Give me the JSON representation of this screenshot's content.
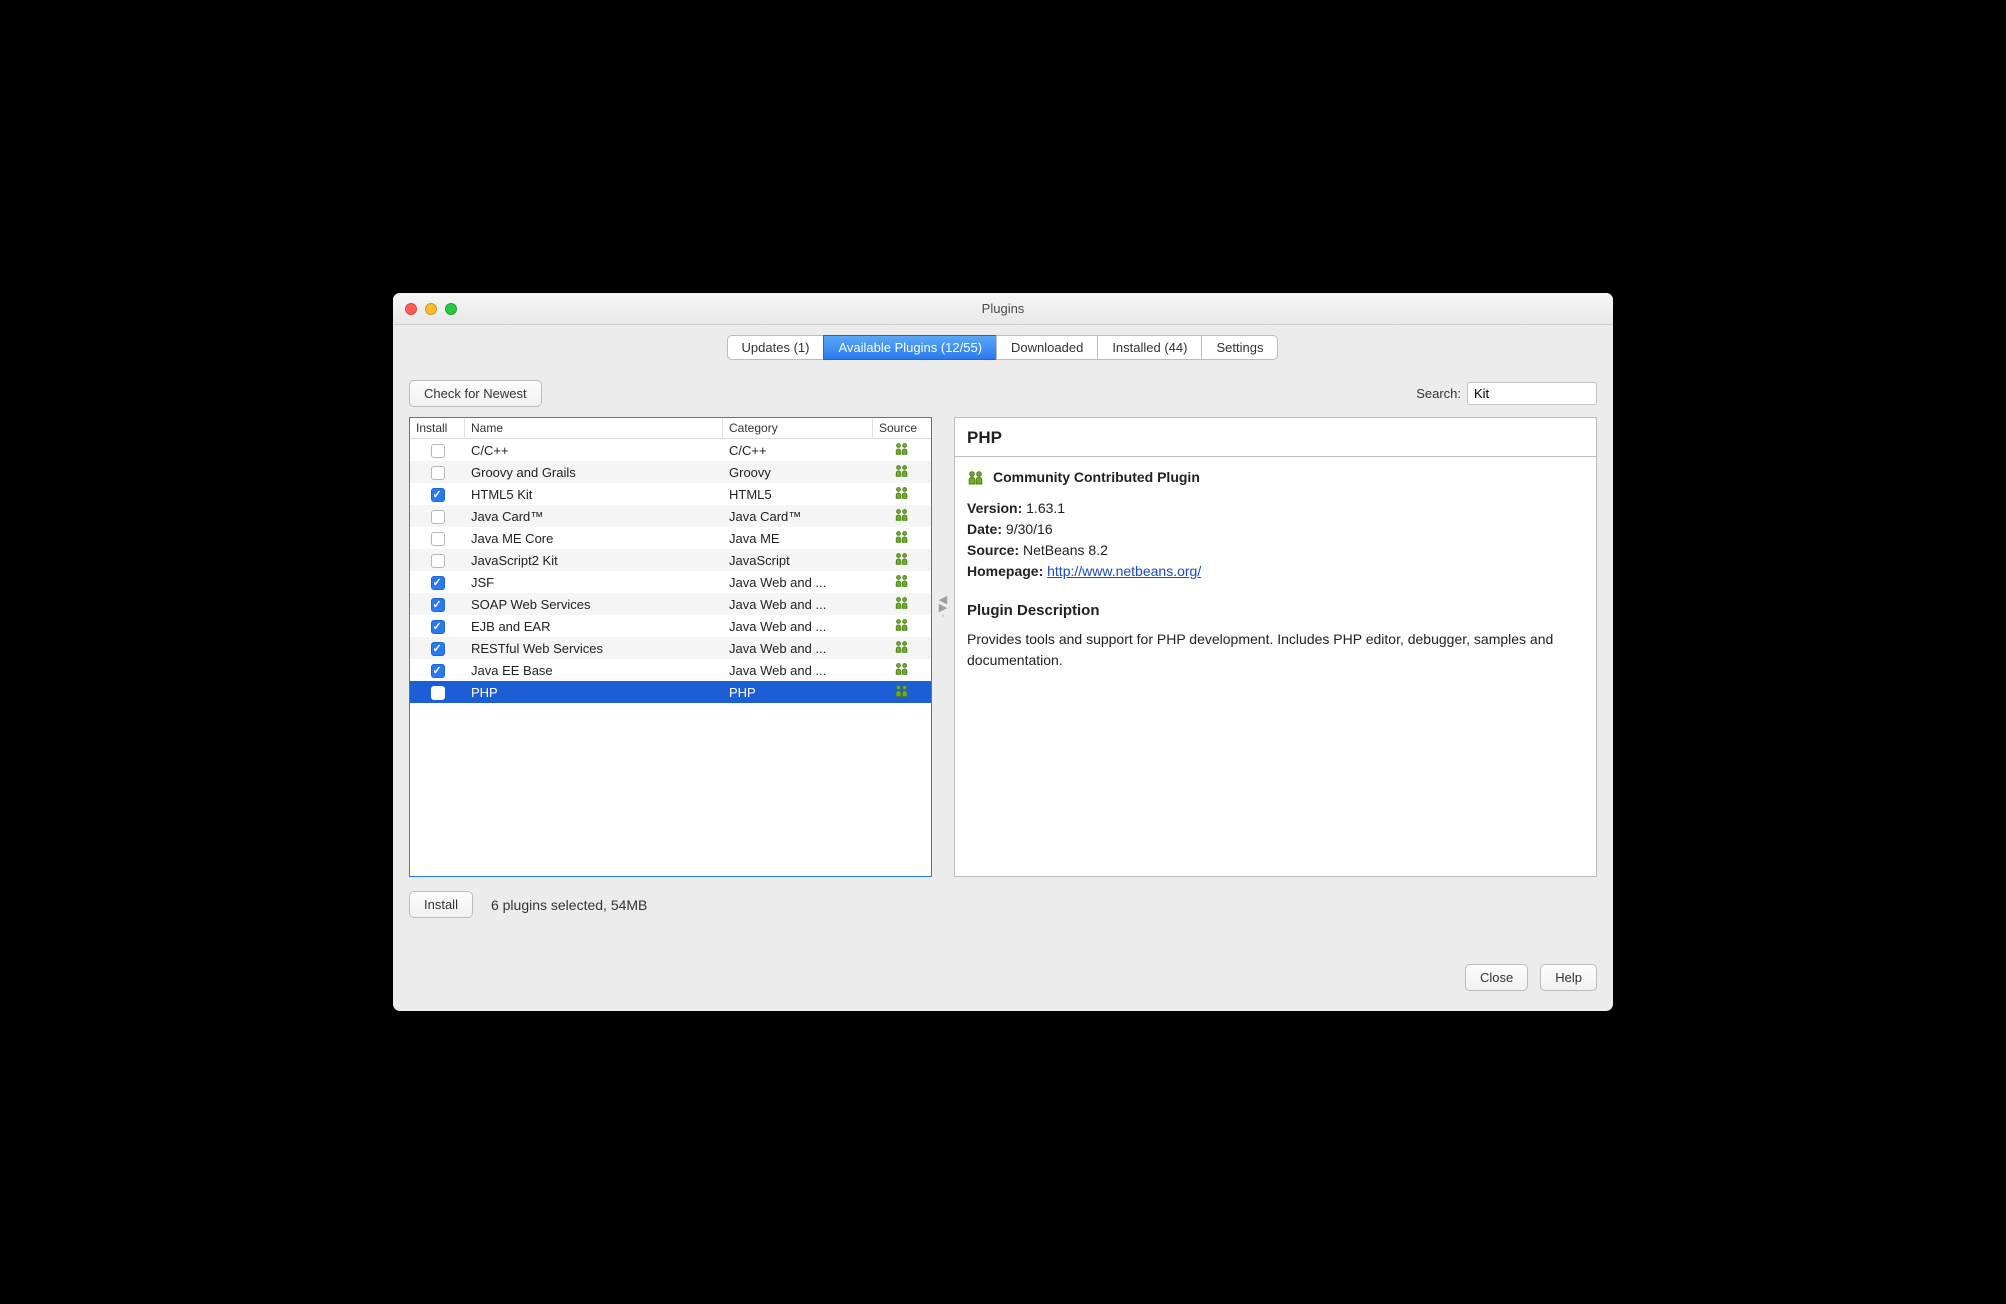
{
  "window": {
    "title": "Plugins"
  },
  "tabs": {
    "updates": "Updates (1)",
    "available": "Available Plugins (12/55)",
    "downloaded": "Downloaded",
    "installed": "Installed (44)",
    "settings": "Settings"
  },
  "toolbar": {
    "check_newest": "Check for Newest",
    "search_label": "Search:",
    "search_value": "Kit"
  },
  "columns": {
    "install": "Install",
    "name": "Name",
    "category": "Category",
    "source": "Source"
  },
  "rows": [
    {
      "checked": false,
      "name": "C/C++",
      "category": "C/C++",
      "selected": false
    },
    {
      "checked": false,
      "name": "Groovy and Grails",
      "category": "Groovy",
      "selected": false
    },
    {
      "checked": true,
      "name": "HTML5 Kit",
      "category": "HTML5",
      "selected": false
    },
    {
      "checked": false,
      "name": "Java Card™",
      "category": "Java Card™",
      "selected": false
    },
    {
      "checked": false,
      "name": "Java ME Core",
      "category": "Java ME",
      "selected": false
    },
    {
      "checked": false,
      "name": "JavaScript2 Kit",
      "category": "JavaScript",
      "selected": false
    },
    {
      "checked": true,
      "name": "JSF",
      "category": "Java Web and ...",
      "selected": false
    },
    {
      "checked": true,
      "name": "SOAP Web Services",
      "category": "Java Web and ...",
      "selected": false
    },
    {
      "checked": true,
      "name": "EJB and EAR",
      "category": "Java Web and ...",
      "selected": false
    },
    {
      "checked": true,
      "name": "RESTful Web Services",
      "category": "Java Web and ...",
      "selected": false
    },
    {
      "checked": true,
      "name": "Java EE Base",
      "category": "Java Web and ...",
      "selected": false
    },
    {
      "checked": false,
      "name": "PHP",
      "category": "PHP",
      "selected": true
    }
  ],
  "details": {
    "title": "PHP",
    "community_label": "Community Contributed Plugin",
    "version_label": "Version:",
    "version": "1.63.1",
    "date_label": "Date:",
    "date": "9/30/16",
    "source_label": "Source:",
    "source": "NetBeans 8.2",
    "homepage_label": "Homepage:",
    "homepage_url": "http://www.netbeans.org/",
    "desc_heading": "Plugin Description",
    "description": "Provides tools and support for PHP development. Includes PHP editor, debugger, samples and documentation."
  },
  "footer": {
    "install": "Install",
    "status": "6 plugins selected, 54MB",
    "close": "Close",
    "help": "Help"
  }
}
